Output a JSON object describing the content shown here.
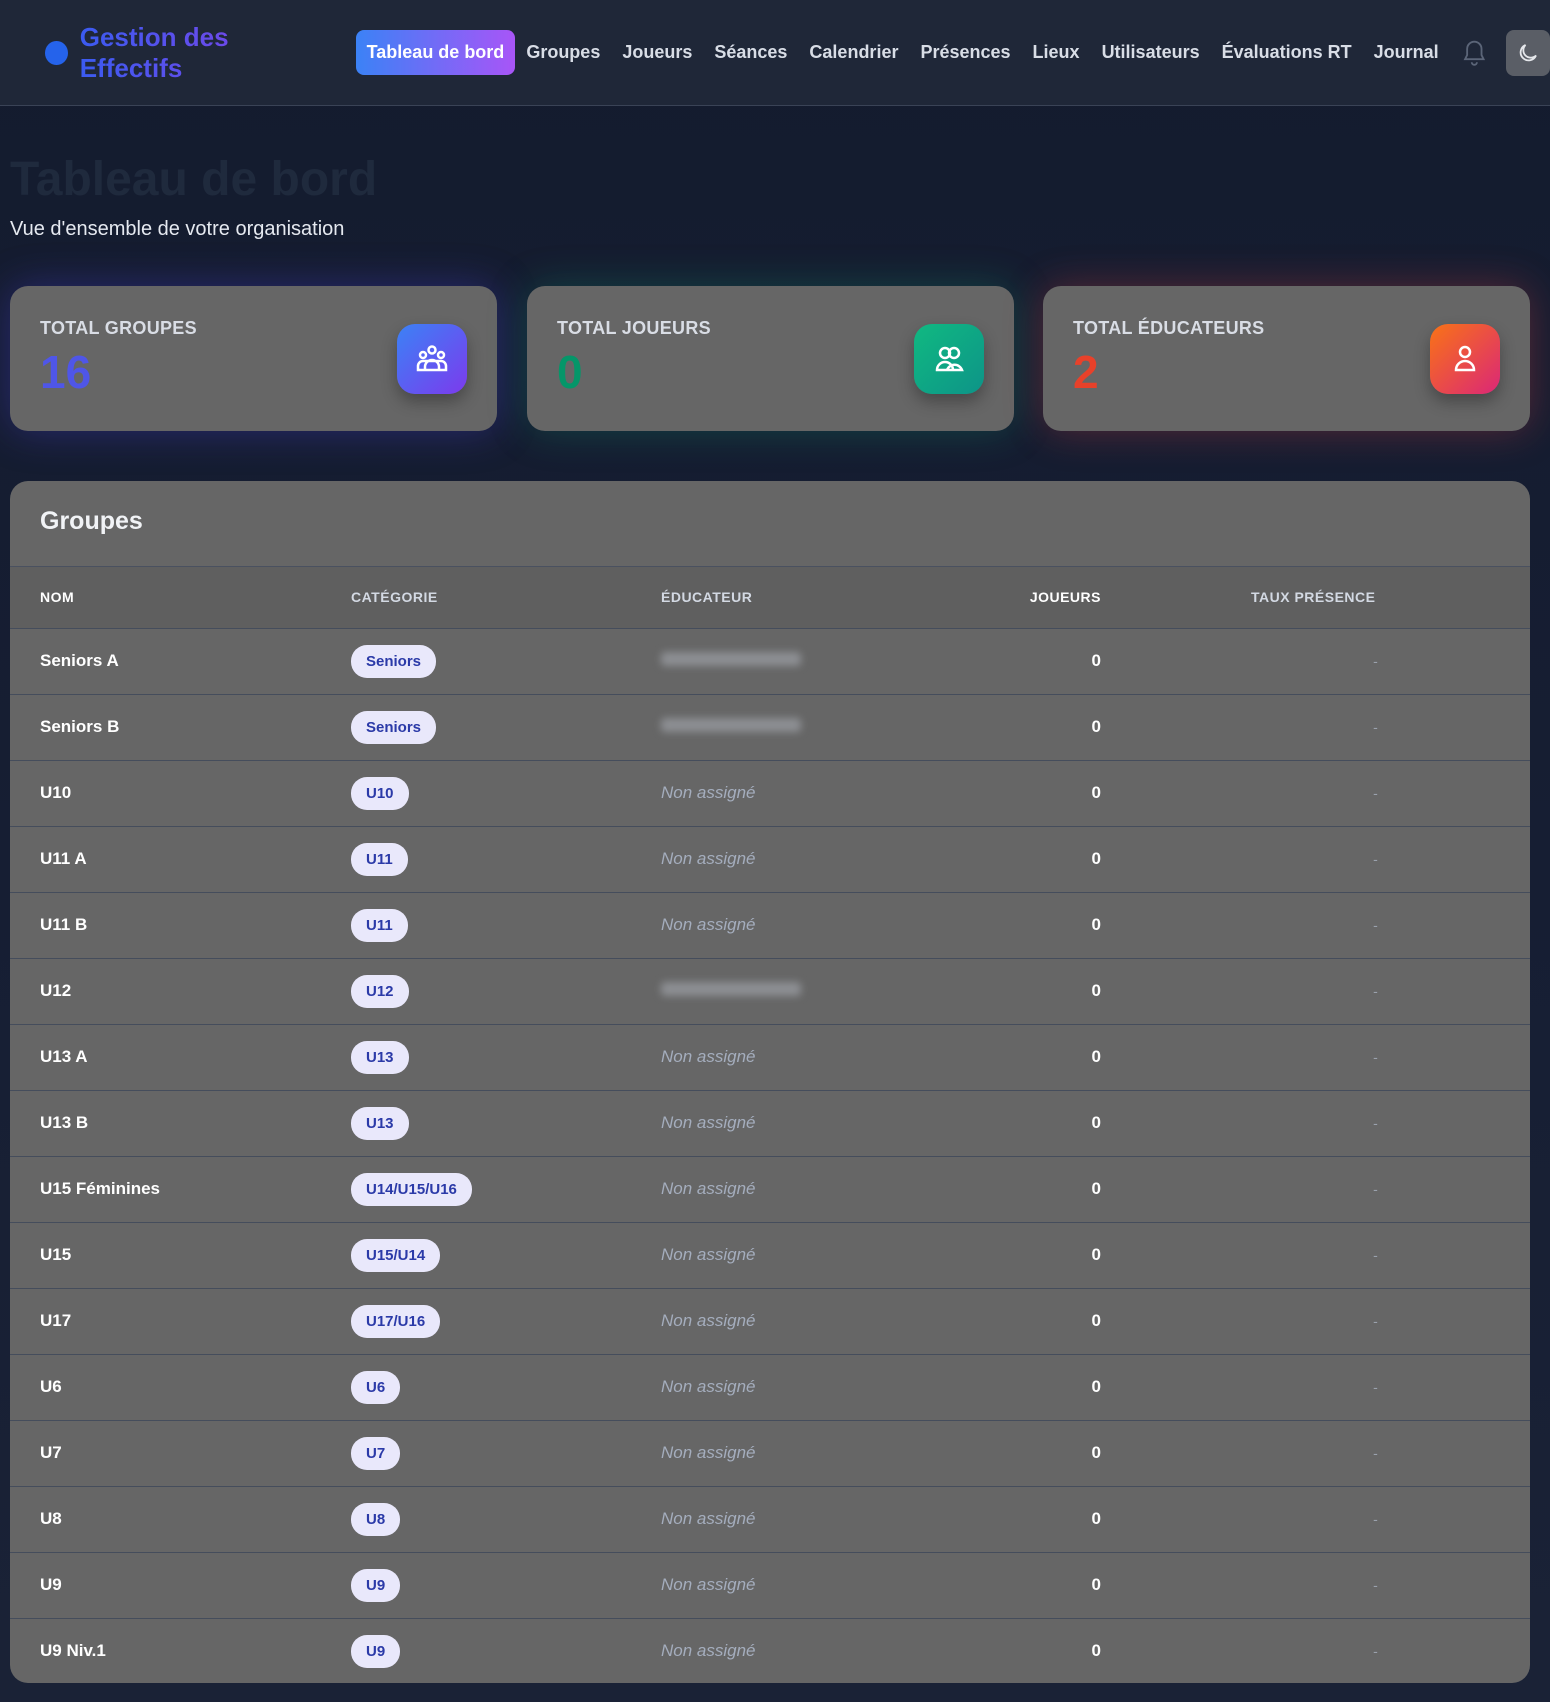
{
  "nav": {
    "brand": "Gestion des Effectifs",
    "items": [
      "Tableau de bord",
      "Groupes",
      "Joueurs",
      "Séances",
      "Calendrier",
      "Présences",
      "Lieux",
      "Utilisateurs",
      "Évaluations RT",
      "Journal"
    ],
    "active": "Tableau de bord",
    "icons": [
      "bell-icon",
      "moon-icon"
    ]
  },
  "page": {
    "title": "Tableau de bord",
    "subtitle": "Vue d'ensemble de votre organisation"
  },
  "stats": [
    {
      "label": "TOTAL GROUPES",
      "value": "16",
      "color": "#4f46e5",
      "icon": "groups-icon"
    },
    {
      "label": "TOTAL JOUEURS",
      "value": "0",
      "color": "#059669",
      "icon": "players-icon"
    },
    {
      "label": "TOTAL ÉDUCATEURS",
      "value": "2",
      "color": "#e8412a",
      "icon": "user-icon"
    }
  ],
  "groups": {
    "title": "Groupes",
    "columns": [
      "NOM",
      "CATÉGORIE",
      "ÉDUCATEUR",
      "JOUEURS",
      "TAUX PRÉSENCE"
    ],
    "rows": [
      {
        "name": "Seniors A",
        "category": "Seniors",
        "educator": null,
        "players": "0",
        "rate": "-"
      },
      {
        "name": "Seniors B",
        "category": "Seniors",
        "educator": null,
        "players": "0",
        "rate": "-"
      },
      {
        "name": "U10",
        "category": "U10",
        "educator": "Non assigné",
        "players": "0",
        "rate": "-"
      },
      {
        "name": "U11 A",
        "category": "U11",
        "educator": "Non assigné",
        "players": "0",
        "rate": "-"
      },
      {
        "name": "U11 B",
        "category": "U11",
        "educator": "Non assigné",
        "players": "0",
        "rate": "-"
      },
      {
        "name": "U12",
        "category": "U12",
        "educator": null,
        "players": "0",
        "rate": "-"
      },
      {
        "name": "U13 A",
        "category": "U13",
        "educator": "Non assigné",
        "players": "0",
        "rate": "-"
      },
      {
        "name": "U13 B",
        "category": "U13",
        "educator": "Non assigné",
        "players": "0",
        "rate": "-"
      },
      {
        "name": "U15 Féminines",
        "category": "U14/U15/U16",
        "educator": "Non assigné",
        "players": "0",
        "rate": "-"
      },
      {
        "name": "U15",
        "category": "U15/U14",
        "educator": "Non assigné",
        "players": "0",
        "rate": "-"
      },
      {
        "name": "U17",
        "category": "U17/U16",
        "educator": "Non assigné",
        "players": "0",
        "rate": "-"
      },
      {
        "name": "U6",
        "category": "U6",
        "educator": "Non assigné",
        "players": "0",
        "rate": "-"
      },
      {
        "name": "U7",
        "category": "U7",
        "educator": "Non assigné",
        "players": "0",
        "rate": "-"
      },
      {
        "name": "U8",
        "category": "U8",
        "educator": "Non assigné",
        "players": "0",
        "rate": "-"
      },
      {
        "name": "U9",
        "category": "U9",
        "educator": "Non assigné",
        "players": "0",
        "rate": "-"
      },
      {
        "name": "U9 Niv.1",
        "category": "U9",
        "educator": "Non assigné",
        "players": "0",
        "rate": "-"
      }
    ]
  }
}
